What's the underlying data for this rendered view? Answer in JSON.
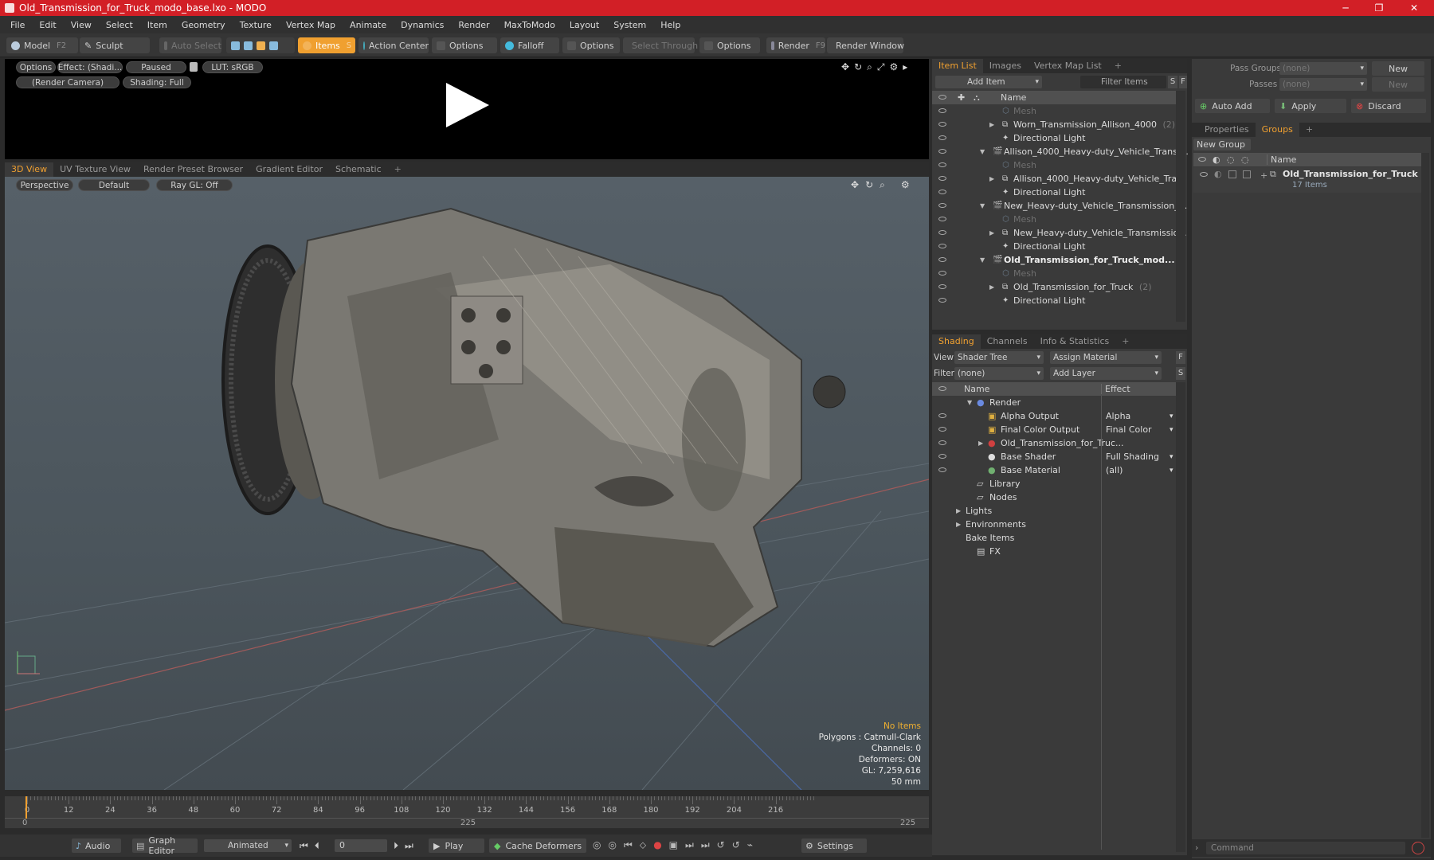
{
  "window": {
    "title": "Old_Transmission_for_Truck_modo_base.lxo - MODO",
    "min": "─",
    "max": "❐",
    "close": "✕"
  },
  "menu": [
    "File",
    "Edit",
    "View",
    "Select",
    "Item",
    "Geometry",
    "Texture",
    "Vertex Map",
    "Animate",
    "Dynamics",
    "Render",
    "MaxToModo",
    "Layout",
    "System",
    "Help"
  ],
  "toolbar": {
    "model": "Model",
    "model_key": "F2",
    "sculpt": "Sculpt",
    "auto_select": "Auto Select",
    "items": "Items",
    "items_badge": "S",
    "action_center": "Action Center",
    "options1": "Options",
    "falloff": "Falloff",
    "options2": "Options",
    "select_through": "Select Through",
    "options3": "Options",
    "render": "Render",
    "render_key": "F9",
    "render_window": "Render Window"
  },
  "preview": {
    "options": "Options",
    "effect": "Effect: (Shadi...",
    "paused": "Paused",
    "lut": "LUT: sRGB",
    "camera": "(Render Camera)",
    "shading": "Shading: Full"
  },
  "viewport_tabs": [
    "3D View",
    "UV Texture View",
    "Render Preset Browser",
    "Gradient Editor",
    "Schematic",
    "+"
  ],
  "viewport": {
    "perspective": "Perspective",
    "default": "Default",
    "raygl": "Ray GL: Off",
    "stats": [
      "No Items",
      "Polygons : Catmull-Clark",
      "Channels: 0",
      "Deformers: ON",
      "GL: 7,259,616",
      "50 mm"
    ]
  },
  "timeline": {
    "ticks": [
      "0",
      "12",
      "24",
      "36",
      "48",
      "60",
      "72",
      "84",
      "96",
      "108",
      "120",
      "132",
      "144",
      "156",
      "168",
      "180",
      "192",
      "204",
      "216"
    ],
    "sub0": "0",
    "sub_mid": "225",
    "sub_end": "225"
  },
  "bottombar": {
    "audio": "Audio",
    "graph_editor": "Graph Editor",
    "animated": "Animated",
    "frame": "0",
    "play": "Play",
    "cache": "Cache Deformers",
    "settings": "Settings"
  },
  "itemlist": {
    "tabs": [
      "Item List",
      "Images",
      "Vertex Map List",
      "+"
    ],
    "add_item": "Add Item",
    "filter": "Filter Items",
    "s": "S",
    "f": "F",
    "col_name": "Name",
    "rows": [
      {
        "label": "Mesh",
        "indent": 3,
        "dim": true,
        "arrow": ""
      },
      {
        "label": "Worn_Transmission_Allison_4000",
        "suffix": "(2)",
        "indent": 3,
        "arrow": "▶"
      },
      {
        "label": "Directional Light",
        "indent": 3,
        "arrow": ""
      },
      {
        "label": "Allison_4000_Heavy-duty_Vehicle_Trans ...",
        "indent": 2,
        "arrow": "▼"
      },
      {
        "label": "Mesh",
        "indent": 3,
        "dim": true,
        "arrow": ""
      },
      {
        "label": "Allison_4000_Heavy-duty_Vehicle_Tra...",
        "indent": 3,
        "arrow": "▶"
      },
      {
        "label": "Directional Light",
        "indent": 3,
        "arrow": ""
      },
      {
        "label": "New_Heavy-duty_Vehicle_Transmission_...",
        "indent": 2,
        "arrow": "▼"
      },
      {
        "label": "Mesh",
        "indent": 3,
        "dim": true,
        "arrow": ""
      },
      {
        "label": "New_Heavy-duty_Vehicle_Transmissio...",
        "indent": 3,
        "arrow": "▶"
      },
      {
        "label": "Directional Light",
        "indent": 3,
        "arrow": ""
      },
      {
        "label": "Old_Transmission_for_Truck_mod...",
        "indent": 2,
        "bold": true,
        "arrow": "▼"
      },
      {
        "label": "Mesh",
        "indent": 3,
        "dim": true,
        "arrow": ""
      },
      {
        "label": "Old_Transmission_for_Truck",
        "suffix": "(2)",
        "indent": 3,
        "arrow": "▶"
      },
      {
        "label": "Directional Light",
        "indent": 3,
        "arrow": ""
      }
    ]
  },
  "shading": {
    "tabs": [
      "Shading",
      "Channels",
      "Info & Statistics",
      "+"
    ],
    "view_label": "View",
    "view_value": "Shader Tree",
    "assign": "Assign Material",
    "f": "F",
    "filter_label": "Filter",
    "filter_value": "(none)",
    "add_layer": "Add Layer",
    "s": "S",
    "col_name": "Name",
    "col_effect": "Effect",
    "rows": [
      {
        "label": "Render",
        "effect": "",
        "indent": 1,
        "arrow": "▼",
        "eye": false
      },
      {
        "label": "Alpha Output",
        "effect": "Alpha",
        "indent": 2,
        "eye": true
      },
      {
        "label": "Final Color Output",
        "effect": "Final Color",
        "indent": 2,
        "eye": true
      },
      {
        "label": "Old_Transmission_for_Truc...",
        "effect": "",
        "indent": 2,
        "arrow": "▶",
        "eye": true
      },
      {
        "label": "Base Shader",
        "effect": "Full Shading",
        "indent": 2,
        "eye": true
      },
      {
        "label": "Base Material",
        "effect": "(all)",
        "indent": 2,
        "eye": true
      },
      {
        "label": "Library",
        "effect": "",
        "indent": 1,
        "eye": false
      },
      {
        "label": "Nodes",
        "effect": "",
        "indent": 1,
        "eye": false
      },
      {
        "label": "Lights",
        "effect": "",
        "indent": 0,
        "arrow": "▶",
        "eye": false
      },
      {
        "label": "Environments",
        "effect": "",
        "indent": 0,
        "arrow": "▶",
        "eye": false
      },
      {
        "label": "Bake Items",
        "effect": "",
        "indent": 0,
        "eye": false
      },
      {
        "label": "FX",
        "effect": "",
        "indent": 1,
        "eye": false
      }
    ]
  },
  "right": {
    "pass_groups": "Pass Groups",
    "pass_groups_value": "(none)",
    "new": "New",
    "passes": "Passes",
    "passes_value": "(none)",
    "new2": "New",
    "auto_add": "Auto Add",
    "apply": "Apply",
    "discard": "Discard",
    "tabs": [
      "Properties",
      "Groups",
      "+"
    ],
    "new_group": "New Group",
    "col_name": "Name",
    "group_name": "Old_Transmission_for_Truck",
    "group_count": "17 Items",
    "command": "Command"
  }
}
